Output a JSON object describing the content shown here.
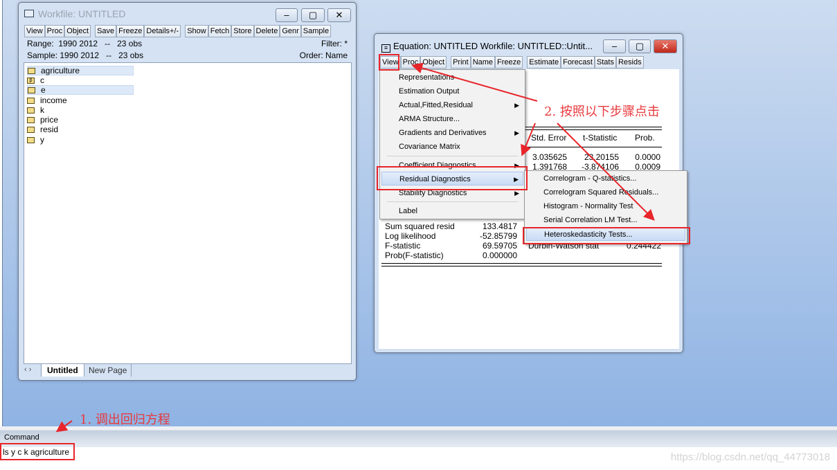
{
  "workfile": {
    "title": "Workfile: UNTITLED",
    "toolbar": [
      "View",
      "Proc",
      "Object",
      "Save",
      "Freeze",
      "Details+/-",
      "Show",
      "Fetch",
      "Store",
      "Delete",
      "Genr",
      "Sample"
    ],
    "range": "Range:  1990 2012   --   23 obs",
    "sample": "Sample: 1990 2012   --   23 obs",
    "filter": "Filter: *",
    "order": "Order: Name",
    "objects": [
      {
        "name": "agriculture",
        "icon": "series-icon"
      },
      {
        "name": "c",
        "icon": "coef-icon"
      },
      {
        "name": "e",
        "icon": "series-icon"
      },
      {
        "name": "income",
        "icon": "series-icon"
      },
      {
        "name": "k",
        "icon": "series-icon"
      },
      {
        "name": "price",
        "icon": "series-icon"
      },
      {
        "name": "resid",
        "icon": "series-icon"
      },
      {
        "name": "y",
        "icon": "series-icon"
      }
    ],
    "tabs": [
      "Untitled",
      "New Page"
    ]
  },
  "equation": {
    "title": "Equation: UNTITLED   Workfile: UNTITLED::Untit...",
    "toolbar": [
      "View",
      "Proc",
      "Object",
      "Print",
      "Name",
      "Freeze",
      "Estimate",
      "Forecast",
      "Stats",
      "Resids"
    ],
    "headers": [
      "Std. Error",
      "t-Statistic",
      "Prob."
    ],
    "rows": [
      [
        "3.035625",
        "23.20155",
        "0.0000"
      ],
      [
        "1.391768",
        "-3.874106",
        "0.0009"
      ]
    ],
    "stats": [
      [
        "Sum squared resid",
        "133.4817"
      ],
      [
        "Log likelihood",
        "-52.85799"
      ],
      [
        "F-statistic",
        "69.59705"
      ],
      [
        "Prob(F-statistic)",
        "0.000000"
      ]
    ],
    "dw": [
      "Durbin-Watson stat",
      "0.244422"
    ]
  },
  "view_menu": [
    "Representations",
    "Estimation Output",
    "Actual,Fitted,Residual",
    "ARMA Structure...",
    "Gradients and Derivatives",
    "Covariance Matrix",
    "Coefficient Diagnostics",
    "Residual Diagnostics",
    "Stability Diagnostics",
    "Label"
  ],
  "submenu": [
    "Correlogram - Q-statistics...",
    "Correlogram Squared Residuals...",
    "Histogram - Normality Test",
    "Serial Correlation LM Test...",
    "Heteroskedasticity Tests..."
  ],
  "command": {
    "label": "Command",
    "value": "ls y c k agriculture"
  },
  "annotations": {
    "step1": "1.  调出回归方程",
    "step2": "2.  按照以下步骤点击"
  },
  "watermark": "https://blog.csdn.net/qq_44773018",
  "colors": {
    "annotation": "#e8252a",
    "desktop": "#8fb3e3"
  }
}
